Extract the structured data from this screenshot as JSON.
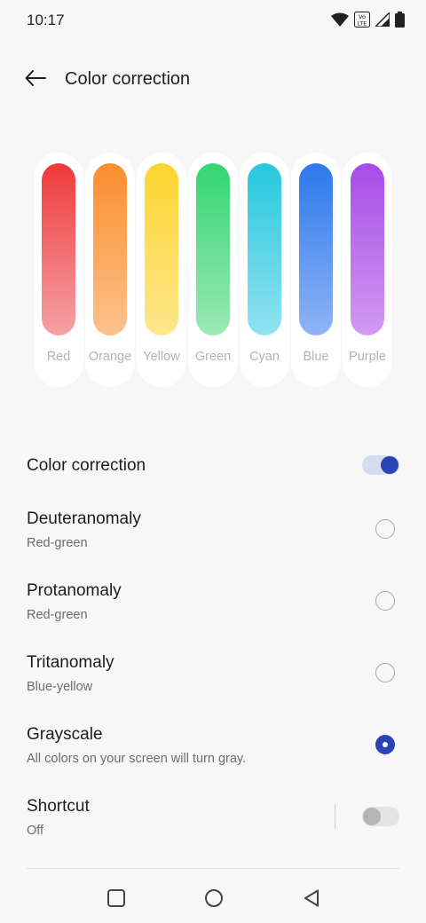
{
  "status_bar": {
    "time": "10:17",
    "icons": [
      "wifi-icon",
      "volte-icon",
      "signal-icon",
      "battery-icon"
    ]
  },
  "header": {
    "title": "Color correction",
    "back_icon": "arrow-left-icon"
  },
  "swatches": [
    {
      "label": "Red",
      "top_color": "#ef3a3b",
      "bottom_color": "#f6a1a6"
    },
    {
      "label": "Orange",
      "top_color": "#fb8d2e",
      "bottom_color": "#fdc28d"
    },
    {
      "label": "Yellow",
      "top_color": "#fdd530",
      "bottom_color": "#fee68c"
    },
    {
      "label": "Green",
      "top_color": "#33d672",
      "bottom_color": "#9ce8b4"
    },
    {
      "label": "Cyan",
      "top_color": "#26c7de",
      "bottom_color": "#92e2f0"
    },
    {
      "label": "Blue",
      "top_color": "#2c78ed",
      "bottom_color": "#8fb4f4"
    },
    {
      "label": "Purple",
      "top_color": "#a64ce8",
      "bottom_color": "#d29bf0"
    }
  ],
  "color_correction": {
    "label": "Color correction",
    "enabled": true
  },
  "modes": [
    {
      "title": "Deuteranomaly",
      "subtitle": "Red-green",
      "selected": false
    },
    {
      "title": "Protanomaly",
      "subtitle": "Red-green",
      "selected": false
    },
    {
      "title": "Tritanomaly",
      "subtitle": "Blue-yellow",
      "selected": false
    },
    {
      "title": "Grayscale",
      "subtitle": "All colors on your screen will turn gray.",
      "selected": true
    }
  ],
  "shortcut": {
    "title": "Shortcut",
    "subtitle": "Off",
    "enabled": false
  },
  "nav_bar": {
    "icons": [
      "recents-square-icon",
      "home-circle-icon",
      "back-triangle-icon"
    ]
  },
  "colors": {
    "accent": "#2a44b8",
    "background": "#f7f7f7"
  }
}
